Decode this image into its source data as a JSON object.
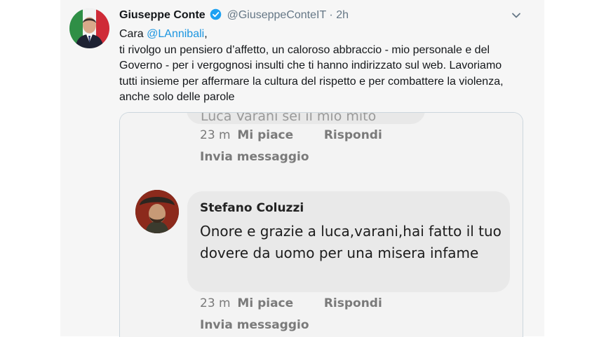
{
  "tweet": {
    "author_name": "Giuseppe Conte",
    "handle": "@GiuseppeConteIT",
    "separator": "·",
    "time": "2h",
    "greeting": "Cara",
    "mention": "@LAnnibali",
    "greeting_end": ",",
    "body": "ti rivolgo un pensiero d’affetto, un caloroso abbraccio - mio personale e del Governo - per i vergognosi insulti che ti hanno indirizzato sul web. Lavoriamo tutti insieme per affermare la cultura del rispetto e per combattere la violenza, anche solo delle parole",
    "icons": {
      "verified": "verified-badge-icon",
      "menu": "chevron-down-icon"
    },
    "colors": {
      "link": "#1b95e0",
      "verified": "#1da1f2"
    }
  },
  "screenshot": {
    "cut_comment_text": "Luca Varani sei il mio mito",
    "comment1_actions": {
      "time": "23 m",
      "like": "Mi piace",
      "reply": "Rispondi",
      "send": "Invia messaggio"
    },
    "comment2": {
      "author": "Stefano Coluzzi",
      "text": "Onore e grazie a luca,varani,hai fatto il tuo dovere da uomo per una misera infame",
      "actions": {
        "time": "23 m",
        "like": "Mi piace",
        "reply": "Rispondi",
        "send": "Invia messaggio"
      }
    }
  }
}
